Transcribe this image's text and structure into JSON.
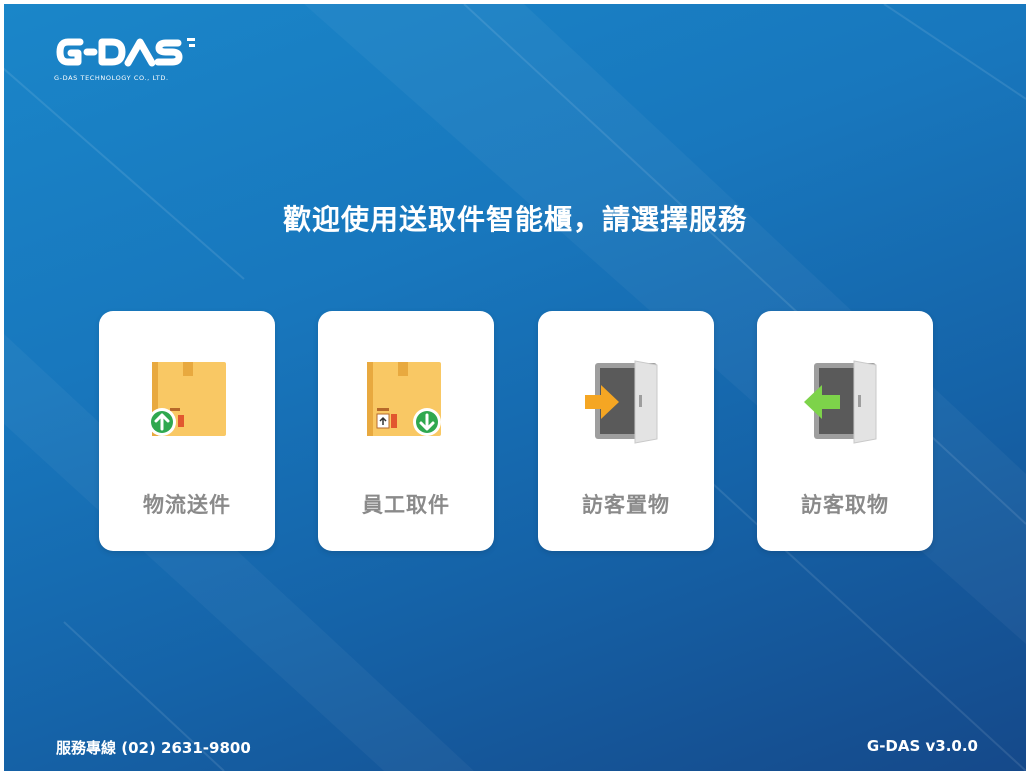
{
  "brand": {
    "logo_text": "G-DAS",
    "tagline": "G-DAS TECHNOLOGY CO., LTD."
  },
  "headline": "歡迎使用送取件智能櫃，請選擇服務",
  "services": [
    {
      "label": "物流送件",
      "icon": "parcel-upload-icon",
      "accent": "#2fa84f"
    },
    {
      "label": "員工取件",
      "icon": "parcel-download-icon",
      "accent": "#2fa84f"
    },
    {
      "label": "訪客置物",
      "icon": "locker-deposit-icon",
      "accent": "#f5a623"
    },
    {
      "label": "訪客取物",
      "icon": "locker-retrieve-icon",
      "accent": "#7dd34a"
    }
  ],
  "footer": {
    "hotline": "服務專線 (02) 2631-9800",
    "version": "G-DAS v3.0.0"
  },
  "colors": {
    "background_top": "#1a86c9",
    "background_bottom": "#15498a",
    "card": "#ffffff",
    "card_label": "#8a8a8a"
  }
}
